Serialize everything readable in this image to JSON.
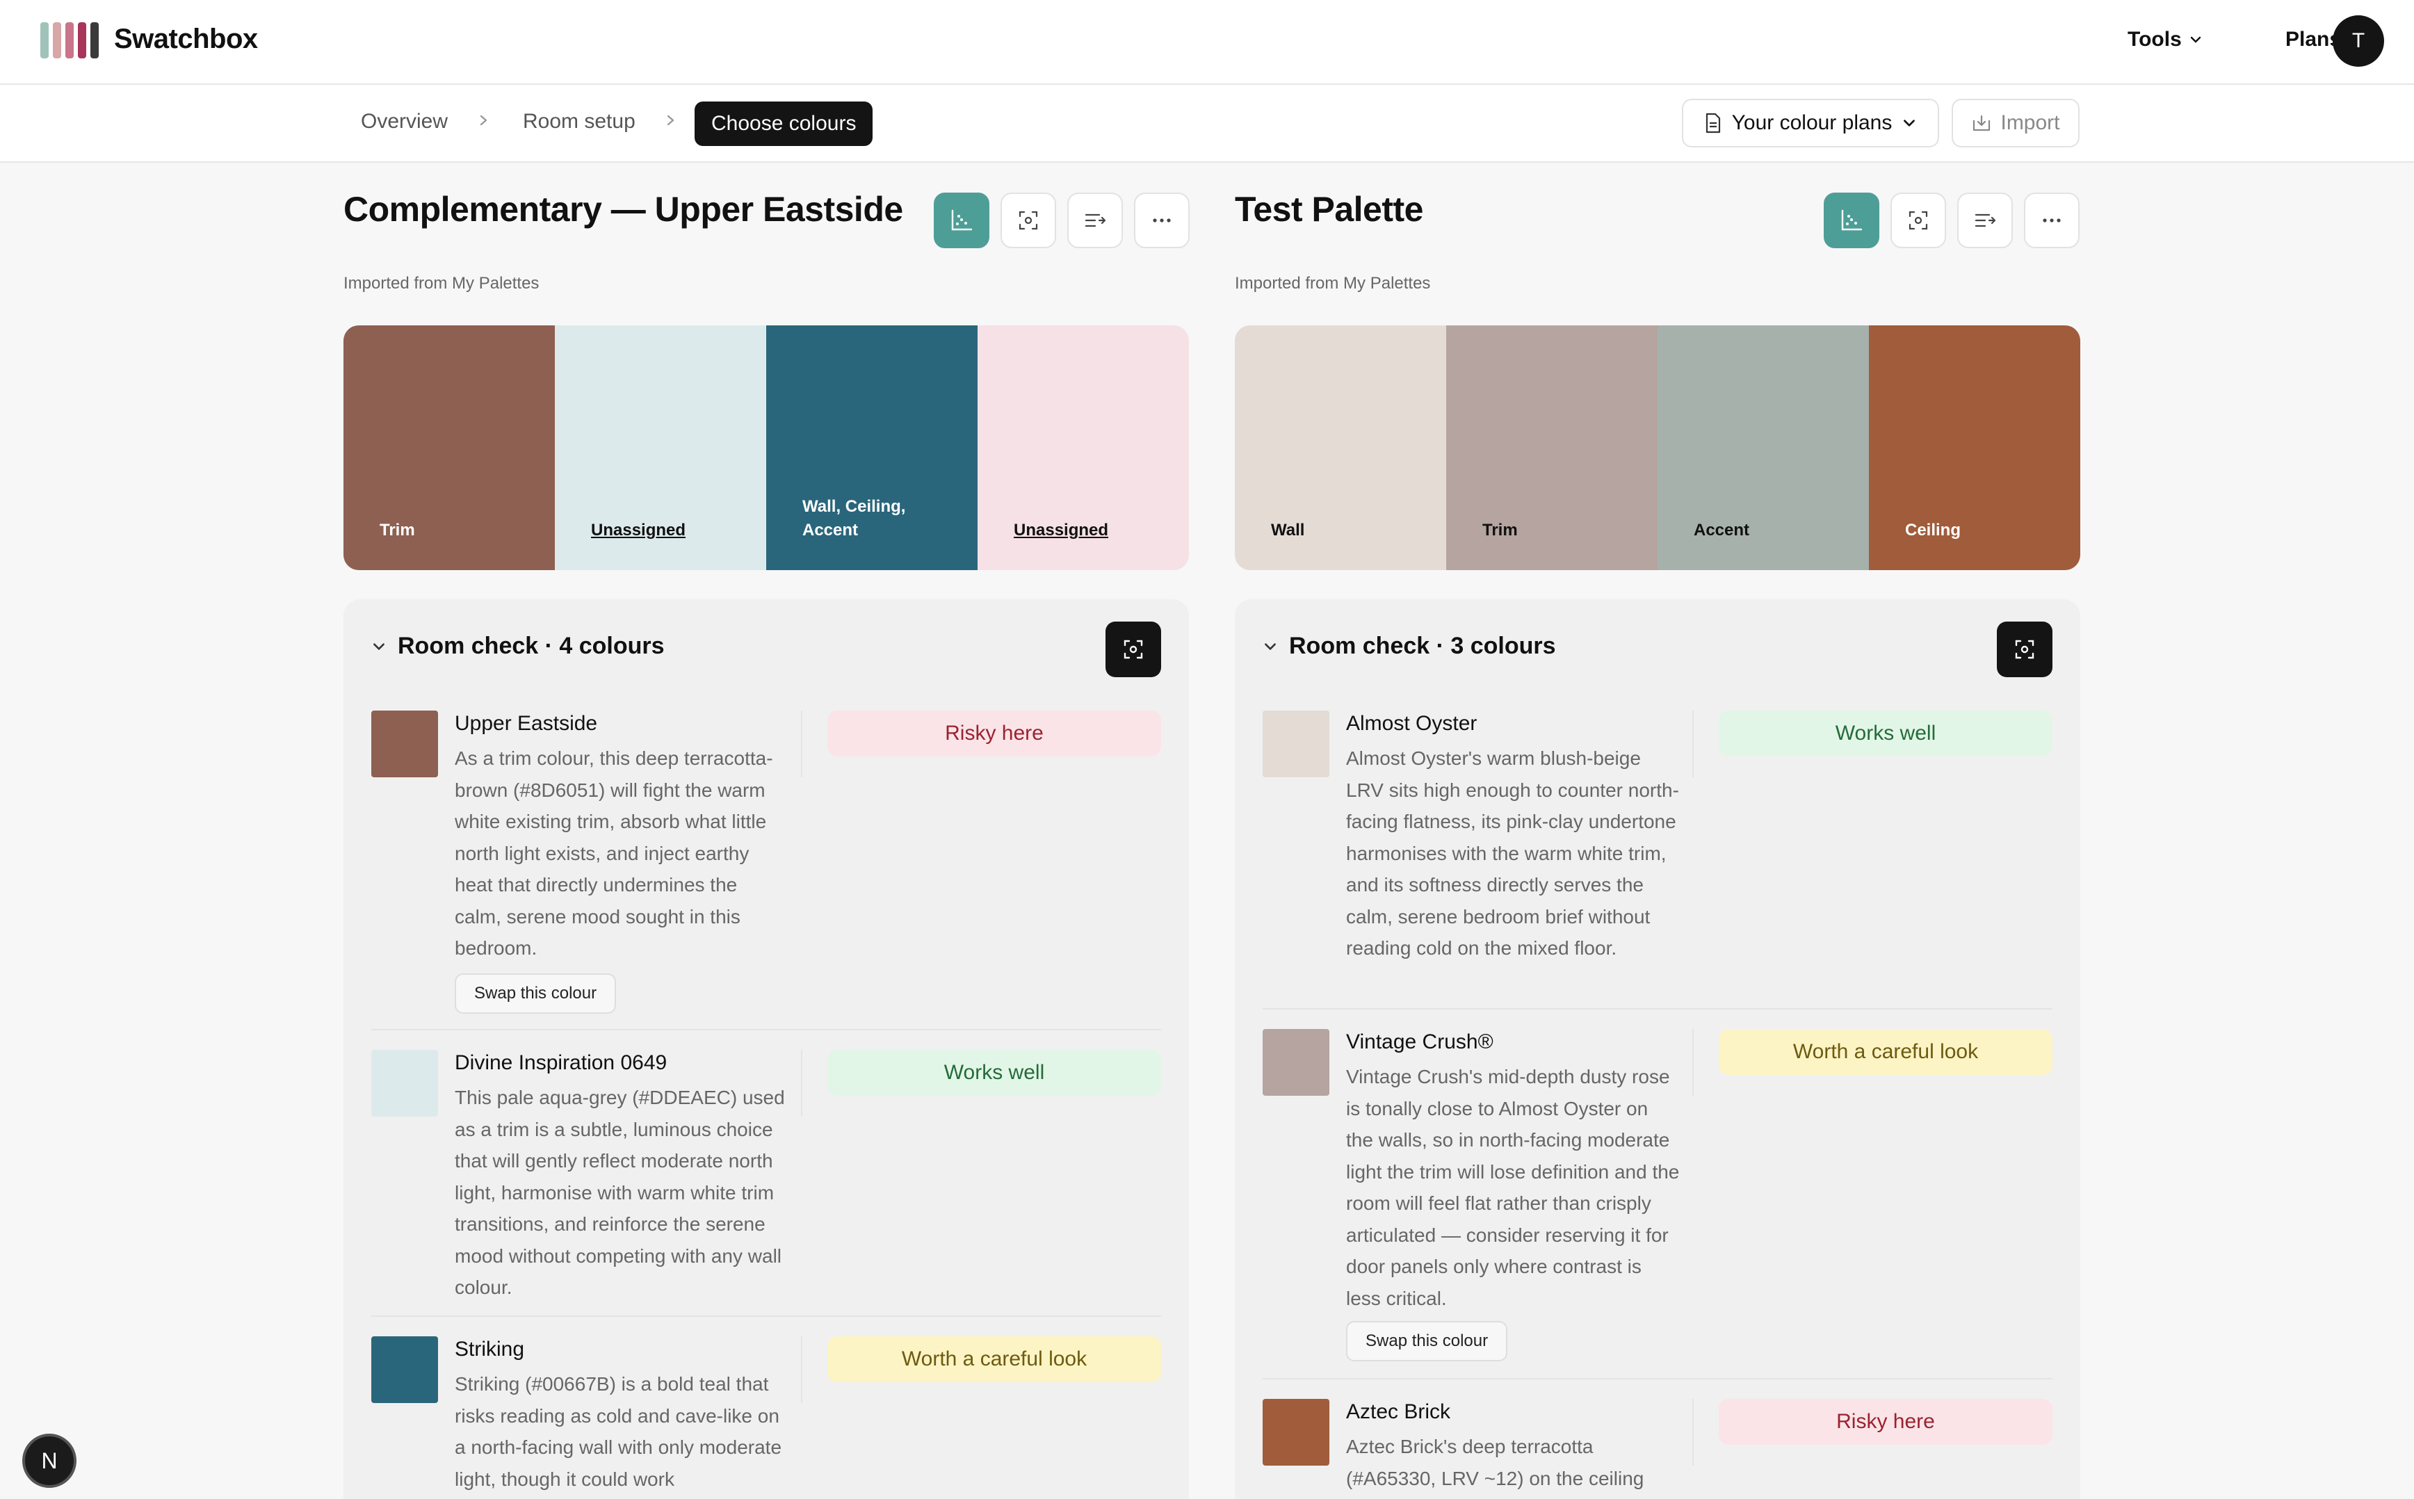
{
  "app": {
    "brand": "Swatchbox",
    "logo_colors": [
      "#9fc3b8",
      "#d8a7a8",
      "#c9748a",
      "#a8355a",
      "#3b3b3b"
    ],
    "nav": {
      "tools": "Tools",
      "plans": "Plans"
    },
    "avatar_initial": "T"
  },
  "steps": {
    "items": [
      "Overview",
      "Room setup"
    ],
    "active": "Choose colours",
    "plans_label": "Your colour plans",
    "import_label": "Import"
  },
  "palettes": [
    {
      "title": "Complementary — Upper Eastside",
      "subtitle": "Imported from My Palettes",
      "swatches": [
        {
          "color": "#8D6051",
          "label": "Trim",
          "label_line2": "",
          "text_color": "#ffffff",
          "underline": false
        },
        {
          "color": "#DDEAEC",
          "label": "Unassigned",
          "label_line2": "",
          "text_color": "#111111",
          "underline": true
        },
        {
          "color": "#2A667B",
          "label": "Wall, Ceiling,",
          "label_line2": "Accent",
          "text_color": "#ffffff",
          "underline": false
        },
        {
          "color": "#F5E1E6",
          "label": "Unassigned",
          "label_line2": "",
          "text_color": "#111111",
          "underline": true
        }
      ],
      "room_check": {
        "heading": "Room check · 4 colours",
        "items": [
          {
            "name": "Upper Eastside",
            "color": "#8D6051",
            "description": "As a trim colour, this deep terracotta-brown (#8D6051) will fight the warm white existing trim, absorb what little north light exists, and inject earthy heat that directly undermines the calm, serene mood sought in this bedroom.",
            "verdict": "Risky here",
            "verdict_type": "risky",
            "swap_label": "Swap this colour"
          },
          {
            "name": "Divine Inspiration 0649",
            "color": "#DDEAEC",
            "description": "This pale aqua-grey (#DDEAEC) used as a trim is a subtle, luminous choice that will gently reflect moderate north light, harmonise with warm white trim transitions, and reinforce the serene mood without competing with any wall colour.",
            "verdict": "Works well",
            "verdict_type": "good",
            "swap_label": ""
          },
          {
            "name": "Striking",
            "color": "#2A667B",
            "description": "Striking (#00667B) is a bold teal that risks reading as cold and cave-like on a north-facing wall with only moderate light, though it could work",
            "verdict": "Worth a careful look",
            "verdict_type": "care",
            "swap_label": ""
          }
        ]
      }
    },
    {
      "title": "Test Palette",
      "subtitle": "Imported from My Palettes",
      "swatches": [
        {
          "color": "#E5DBD5",
          "label": "Wall",
          "label_line2": "",
          "text_color": "#111111",
          "underline": false
        },
        {
          "color": "#B5A49F",
          "label": "Trim",
          "label_line2": "",
          "text_color": "#111111",
          "underline": false
        },
        {
          "color": "#A6B1AC",
          "label": "Accent",
          "label_line2": "",
          "text_color": "#111111",
          "underline": false
        },
        {
          "color": "#A05C3B",
          "label": "Ceiling",
          "label_line2": "",
          "text_color": "#ffffff",
          "underline": false
        }
      ],
      "room_check": {
        "heading": "Room check · 3 colours",
        "items": [
          {
            "name": "Almost Oyster",
            "color": "#E5DBD5",
            "description": "Almost Oyster's warm blush-beige LRV sits high enough to counter north-facing flatness, its pink-clay undertone harmonises with the warm white trim, and its softness directly serves the calm, serene bedroom brief without reading cold on the mixed floor.",
            "verdict": "Works well",
            "verdict_type": "good",
            "swap_label": ""
          },
          {
            "name": "Vintage Crush®",
            "color": "#B5A49F",
            "description": "Vintage Crush's mid-depth dusty rose is tonally close to Almost Oyster on the walls, so in north-facing moderate light the trim will lose definition and the room will feel flat rather than crisply articulated — consider reserving it for door panels only where contrast is less critical.",
            "verdict": "Worth a careful look",
            "verdict_type": "care",
            "swap_label": "Swap this colour"
          },
          {
            "name": "Aztec Brick",
            "color": "#A05C3B",
            "description": "Aztec Brick's deep terracotta (#A65330, LRV ~12) on the ceiling",
            "verdict": "Risky here",
            "verdict_type": "risky",
            "swap_label": ""
          }
        ]
      }
    }
  ],
  "dev_badge": "N"
}
